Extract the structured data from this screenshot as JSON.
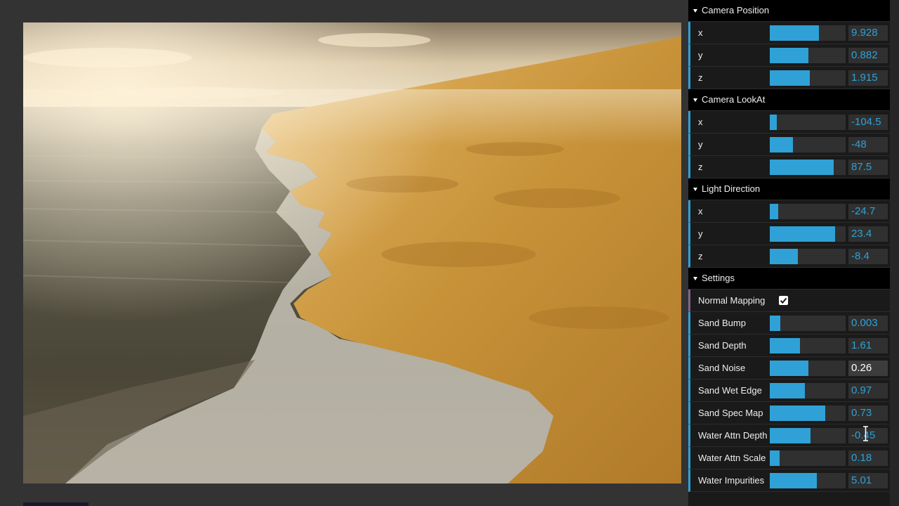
{
  "gui": {
    "folders": [
      {
        "title": "Camera Position",
        "rows": [
          {
            "label": "x",
            "value": "9.928",
            "fill": 0.65
          },
          {
            "label": "y",
            "value": "0.882",
            "fill": 0.51
          },
          {
            "label": "z",
            "value": "1.915",
            "fill": 0.53
          }
        ]
      },
      {
        "title": "Camera LookAt",
        "rows": [
          {
            "label": "x",
            "value": "-104.5",
            "fill": 0.09
          },
          {
            "label": "y",
            "value": "-48",
            "fill": 0.31
          },
          {
            "label": "z",
            "value": "87.5",
            "fill": 0.84
          }
        ]
      },
      {
        "title": "Light Direction",
        "rows": [
          {
            "label": "x",
            "value": "-24.7",
            "fill": 0.11
          },
          {
            "label": "y",
            "value": "23.4",
            "fill": 0.86
          },
          {
            "label": "z",
            "value": "-8.4",
            "fill": 0.37
          }
        ]
      },
      {
        "title": "Settings",
        "rows": [
          {
            "label": "Normal Mapping",
            "type": "checkbox",
            "checked": true
          },
          {
            "label": "Sand Bump",
            "value": "0.003",
            "fill": 0.14
          },
          {
            "label": "Sand Depth",
            "value": "1.61",
            "fill": 0.4
          },
          {
            "label": "Sand Noise",
            "value": "0.26",
            "fill": 0.51,
            "active": true
          },
          {
            "label": "Sand Wet Edge",
            "value": "0.97",
            "fill": 0.46
          },
          {
            "label": "Sand Spec Map",
            "value": "0.73",
            "fill": 0.73
          },
          {
            "label": "Water Attn Depth",
            "value": "-0.45",
            "fill": 0.54
          },
          {
            "label": "Water Attn Scale",
            "value": "0.18",
            "fill": 0.13
          },
          {
            "label": "Water Impurities",
            "value": "5.01",
            "fill": 0.62
          }
        ]
      }
    ]
  },
  "colors": {
    "accent": "#2fa1d6",
    "panel_bg": "#1a1a1a",
    "folder_bg": "#000000",
    "sand": "#c8963c",
    "water": "#5e5a4a"
  },
  "icons": {
    "caret": "caret-down-icon",
    "checkbox": "checkmark-icon",
    "cursor": "text-cursor-icon"
  }
}
